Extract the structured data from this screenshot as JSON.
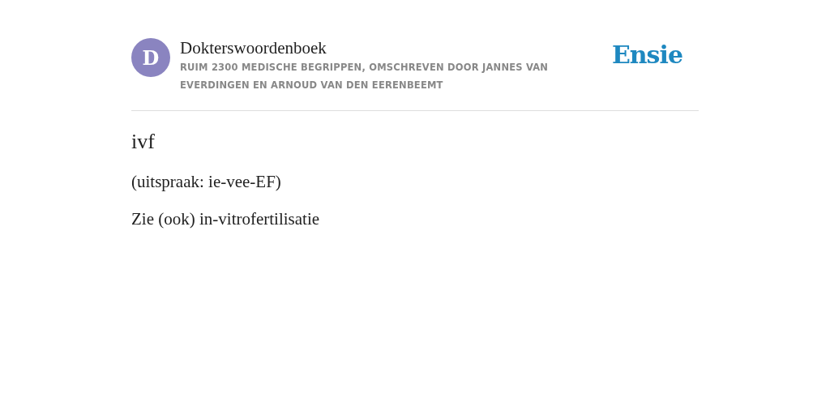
{
  "header": {
    "avatar_letter": "D",
    "title": "Dokterswoordenboek",
    "subtitle": "RUIM 2300 MEDISCHE BEGRIPPEN, OMSCHREVEN DOOR JANNES VAN EVERDINGEN EN ARNOUD VAN DEN EERENBEEMT",
    "logo": "Ensie"
  },
  "entry": {
    "term": "ivf",
    "paragraphs": [
      "(uitspraak: ie-vee-EF)",
      "Zie (ook) in-vitrofertilisatie"
    ]
  }
}
